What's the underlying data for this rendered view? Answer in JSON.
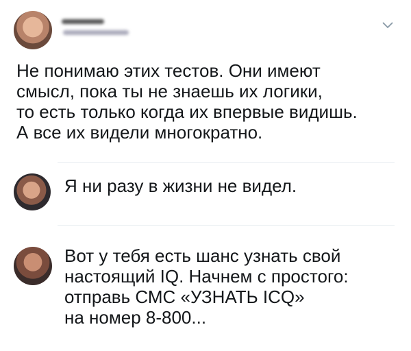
{
  "tweet": {
    "author_avatar": "user-avatar",
    "menu_icon": "chevron-down-icon",
    "text": "Не понимаю этих тестов. Они имеют\nсмысл, пока ты не знаешь их логики,\nто есть только когда их впервые видишь.\nА все их видели многократно."
  },
  "replies": [
    {
      "avatar": "user-avatar",
      "text": "Я ни разу в жизни не видел."
    },
    {
      "avatar": "user-avatar",
      "text": "Вот у тебя есть шанс узнать свой\nнастоящий IQ. Начнем с простого:\nотправь СМС «УЗНАТЬ ICQ»\nна номер 8-800..."
    }
  ],
  "colors": {
    "text": "#14171a",
    "divider": "#e6ecf0",
    "icon": "#8899a6"
  }
}
